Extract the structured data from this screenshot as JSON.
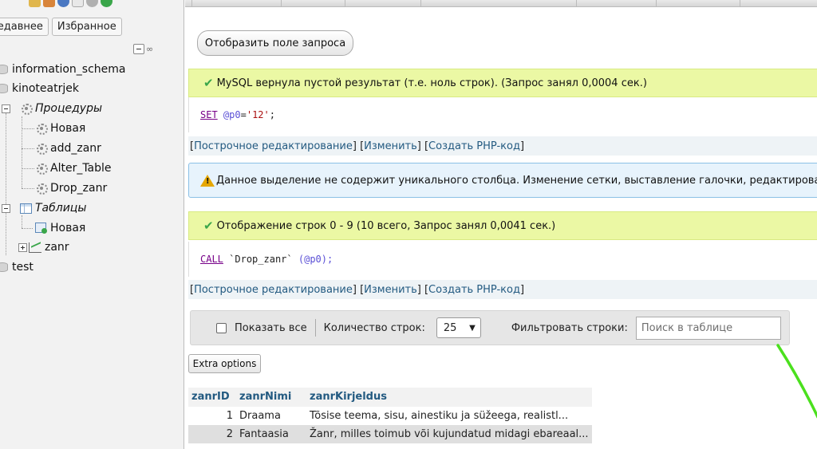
{
  "sidebar": {
    "tabs": {
      "recent": "Недавнее",
      "favorites": "Избранное"
    },
    "tree": {
      "db1": "information_schema",
      "db2": "kinoteatrjek",
      "procedures": "Процедуры",
      "proc_new": "Новая",
      "proc1": "add_zanr",
      "proc2": "Alter_Table",
      "proc3": "Drop_zanr",
      "tables": "Таблицы",
      "table_new": "Новая",
      "table1": "zanr",
      "db3": "test"
    }
  },
  "main": {
    "show_query_label": "Отобразить поле запроса",
    "msg1": "MySQL вернула пустой результат (т.е. ноль строк). (Запрос занял 0,0004 сек.)",
    "sql1": {
      "kw": "SET",
      "sp": " ",
      "var": "@p0",
      "eq": "=",
      "str": "'12'",
      "end": ";"
    },
    "links": {
      "open": "[ ",
      "inline_edit": "Построчное редактирование",
      "sep1": " ] [ ",
      "edit": "Изменить",
      "sep2": " ] [ ",
      "create_php": "Создать PHP-код",
      "close": " ]"
    },
    "notice": "Данное выделение не содержит уникального столбца. Изменение сетки, выставление галочки, редактирование, к",
    "msg2": "Отображение строк 0 - 9 (10 всего, Запрос занял 0,0041 сек.)",
    "sql2": {
      "kw": "CALL",
      "sp": " ",
      "name": "`Drop_zanr`",
      "sp2": " ",
      "open": "(",
      "var": "@p0",
      "close": ");"
    },
    "nav": {
      "show_all": "Показать все",
      "row_count_label": "Количество строк:",
      "row_count_value": "25",
      "filter_label": "Фильтровать строки:",
      "filter_placeholder": "Поиск в таблице"
    },
    "extra_options": "Extra options",
    "table": {
      "headers": [
        "zanrID",
        "zanrNimi",
        "zanrKirjeldus"
      ],
      "rows": [
        [
          "1",
          "Draama",
          "Tõsise teema, sisu, ainestiku ja süžeega, realistl..."
        ],
        [
          "2",
          "Fantaasia",
          "Žanr, milles toimub või kujundatud midagi ebareaal..."
        ]
      ]
    }
  },
  "colors": {
    "success_bg": "#ebf8a4",
    "notice_bg": "#e7f3fc",
    "link": "#235a81",
    "annotation": "#4be01e"
  }
}
